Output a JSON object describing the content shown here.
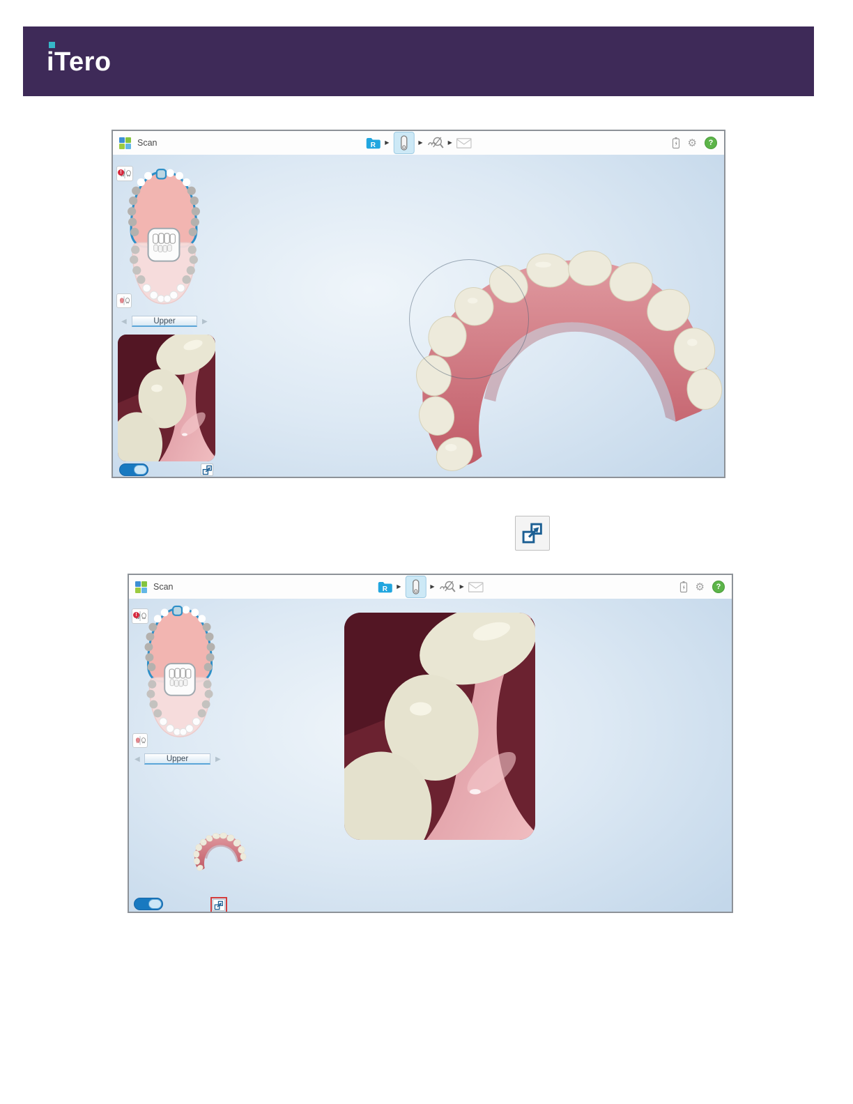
{
  "banner": {
    "logo": "iTero"
  },
  "screen": {
    "title": "Scan",
    "workflow": {
      "record_letter": "R",
      "step_arrow": "▶",
      "steps": [
        "patient-record",
        "scan",
        "view",
        "send"
      ],
      "active_step": "scan"
    },
    "toolbar": {
      "gear_glyph": "⚙",
      "help_glyph": "?"
    },
    "sidebar": {
      "arch_label": "Upper",
      "prev_glyph": "◀",
      "next_glyph": "▶",
      "alert_glyph": "!"
    }
  },
  "icons": {
    "apps_grid": "four-color-squares",
    "patient_record": "blue-folder-R",
    "scan_step": "scanner-wand",
    "view_step": "magnifier-teeth",
    "send_step": "envelope",
    "battery": "battery-charging",
    "settings": "gear",
    "help": "question-circle",
    "enlarge_toggle": "overlapping-squares-arrow"
  },
  "colors": {
    "banner_purple": "#3e2a58",
    "logo_teal": "#36b7c8",
    "accent_blue": "#1b75bb",
    "folder_blue": "#21a6df",
    "active_step_bg": "#cde9f6",
    "help_green": "#5cb449",
    "highlight_red": "#d43c3c",
    "gum_pink": "#d4747e",
    "tooth_cream": "#ebe8d6"
  }
}
